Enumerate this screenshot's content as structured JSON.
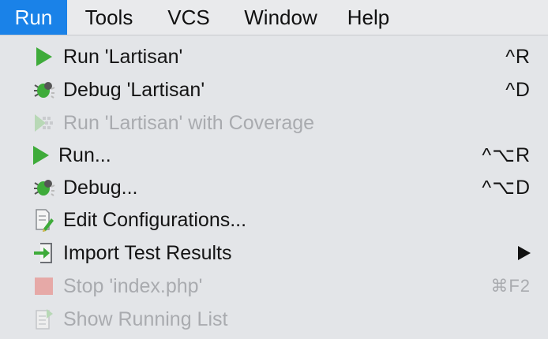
{
  "menubar": {
    "items": [
      {
        "label": "Run",
        "active": true
      },
      {
        "label": "Tools"
      },
      {
        "label": "VCS"
      },
      {
        "label": "Window"
      },
      {
        "label": "Help"
      }
    ]
  },
  "menu": {
    "items": [
      {
        "label": "Run 'Lartisan'",
        "shortcut": "^R",
        "icon": "run-icon",
        "enabled": true
      },
      {
        "label": "Debug 'Lartisan'",
        "shortcut": "^D",
        "icon": "debug-icon",
        "enabled": true
      },
      {
        "label": "Run 'Lartisan' with Coverage",
        "shortcut": "",
        "icon": "coverage-icon",
        "enabled": false
      },
      {
        "label": "Run...",
        "shortcut": "^⌥R",
        "icon": "run-icon",
        "enabled": true
      },
      {
        "label": "Debug...",
        "shortcut": "^⌥D",
        "icon": "debug-icon",
        "enabled": true
      },
      {
        "label": "Edit Configurations...",
        "shortcut": "",
        "icon": "edit-configurations-icon",
        "enabled": true
      },
      {
        "label": "Import Test Results",
        "shortcut": "",
        "icon": "import-icon",
        "enabled": true,
        "submenu": true
      },
      {
        "label": "Stop 'index.php'",
        "shortcut": "⌘F2",
        "icon": "stop-icon",
        "enabled": false
      },
      {
        "label": "Show Running List",
        "shortcut": "",
        "icon": "running-list-icon",
        "enabled": false
      }
    ]
  },
  "colors": {
    "accent": "#1a82e8",
    "run_green": "#3eab3a",
    "disabled": "#a9abaf"
  }
}
